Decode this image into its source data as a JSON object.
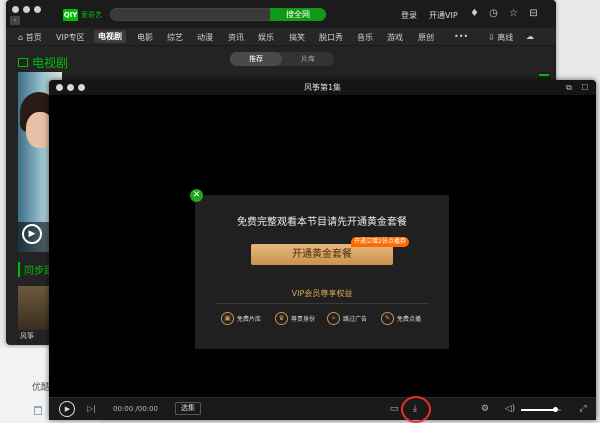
{
  "main_window": {
    "logo_text": "爱奇艺",
    "logo_mark": "QIY",
    "search_button": "搜全网",
    "top_links": [
      "登录",
      "开通VIP"
    ],
    "nav": [
      "首页",
      "VIP专区",
      "电视剧",
      "电影",
      "综艺",
      "动漫",
      "资讯",
      "娱乐",
      "搞笑",
      "脱口秀",
      "音乐",
      "游戏",
      "原创",
      "•••",
      "离线"
    ],
    "active_nav": "电视剧",
    "section_title": "电视剧",
    "segments": [
      "推荐",
      "片库"
    ],
    "sync_title": "同步跟",
    "thumb_caption": "风筝",
    "icons": [
      "home-icon",
      "bulb-icon",
      "clock-icon",
      "star-icon",
      "minimize-icon",
      "download-icon",
      "cloud-icon"
    ]
  },
  "background": {
    "partial_text": "优酷"
  },
  "player": {
    "title": "风筝第1集",
    "dialog": {
      "message": "免费完整观看本节目请先开通黄金套餐",
      "button": "开通黄金套餐",
      "badge": "开通立赠2张点播券",
      "vip_heading": "VIP会员尊享权益",
      "perks": [
        {
          "label": "免费片库",
          "icon": "film-icon"
        },
        {
          "label": "尊贵身份",
          "icon": "crown-icon"
        },
        {
          "label": "跳过广告",
          "icon": "skip-icon"
        },
        {
          "label": "免费点播",
          "icon": "ticket-icon"
        }
      ]
    },
    "controls": {
      "time": "00:00 /00:00",
      "episodes_label": "选集",
      "volume": 0.85
    }
  },
  "colors": {
    "brand_green": "#00be06",
    "gold": "#d8a95c",
    "badge_orange": "#ff6a00",
    "highlight_red": "#e53030"
  }
}
